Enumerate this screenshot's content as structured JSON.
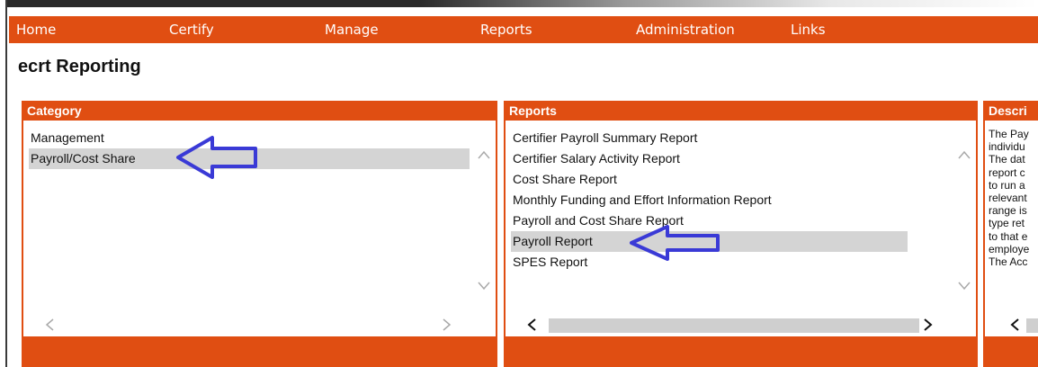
{
  "nav": {
    "items": [
      "Home",
      "Certify",
      "Manage",
      "Reports",
      "Administration",
      "Links"
    ]
  },
  "page": {
    "title": "ecrt Reporting"
  },
  "category": {
    "header": "Category",
    "items": [
      "Management",
      "Payroll/Cost Share"
    ],
    "selected": "Payroll/Cost Share"
  },
  "reports": {
    "header": "Reports",
    "items": [
      "Certifier Payroll Summary Report",
      "Certifier Salary Activity Report",
      "Cost Share Report",
      "Monthly Funding and Effort Information Report",
      "Payroll and Cost Share Report",
      "Payroll Report",
      "SPES Report"
    ],
    "selected": "Payroll Report"
  },
  "description": {
    "header": "Descri",
    "lines": [
      "The Pay",
      "individu",
      "The dat",
      "report c",
      "to run a",
      "relevant",
      "range is",
      "type ret",
      "to that e",
      "employe",
      "The Acc"
    ]
  },
  "icons": {
    "arrow": "left-arrow-annotation-icon",
    "scroll_up": "chevron-up-icon",
    "scroll_down": "chevron-down-icon",
    "scroll_left": "chevron-left-icon",
    "scroll_right": "chevron-right-icon"
  },
  "colors": {
    "accent": "#e04e12",
    "selection": "#d4d4d4",
    "annotation_arrow": "#3a3ad6"
  }
}
